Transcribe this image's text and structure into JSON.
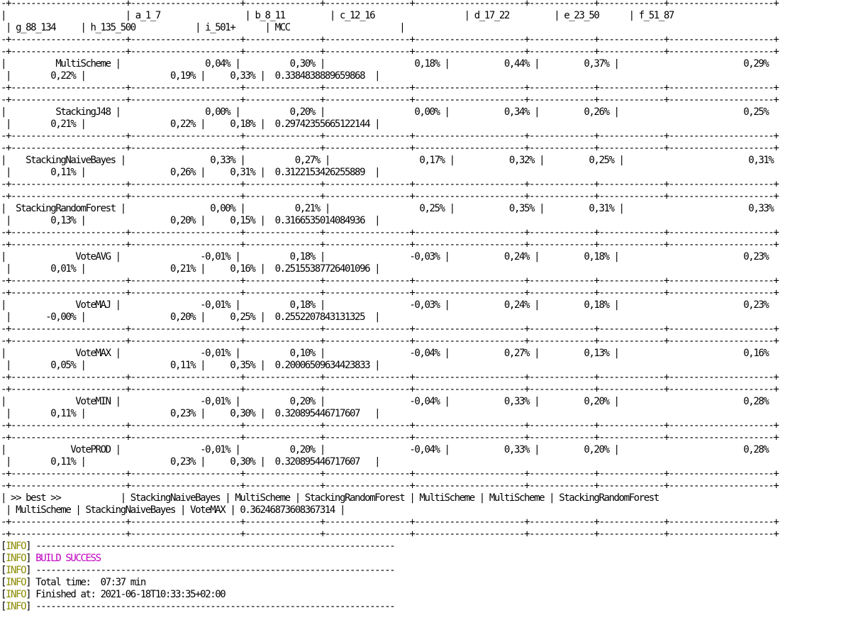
{
  "colors": {
    "background": "#ffffff",
    "text": "#000000",
    "info_label": "#8b8b00",
    "build_success": "#c000c0"
  },
  "table": {
    "border_line": "-+-----------------------+----------------------+---------------+-----------------+----------------------+-------------+-------------+---------------------+",
    "header": [
      "|                        | a_1_7                 | b_8_11         | c_12_16                  | d_17_22         | e_23_50      | f_51_87",
      " | g_88_134     | h_135_500            | i_501+      | MCC                      |"
    ],
    "rows": [
      {
        "name": "MultiScheme",
        "lines": [
          "|          MultiScheme |                 0,04% |          0,30% |                  0,18% |           0,44% |         0,37% |                         0,29%",
          " |        0,22% |                 0,19% |     0,33% |  0.3384838889659868  |"
        ]
      },
      {
        "name": "StackingJ48",
        "lines": [
          "|          StackingJ48 |                 0,00% |          0,20% |                  0,00% |           0,34% |         0,26% |                         0,25%",
          " |        0,21% |                 0,22% |     0,18% |  0.29742355665122144 |"
        ]
      },
      {
        "name": "StackingNaiveBayes",
        "lines": [
          "|    StackingNaiveBayes |                 0,33% |          0,27% |                  0,17% |           0,32% |         0,25% |                         0,31%",
          " |        0,11% |                 0,26% |     0,31% |  0.3122153426255889  |"
        ]
      },
      {
        "name": "StackingRandomForest",
        "lines": [
          "|  StackingRandomForest |                 0,00% |          0,21% |                  0,25% |           0,35% |         0,31% |                         0,33%",
          " |        0,13% |                 0,20% |     0,15% |  0.3166535014084936  |"
        ]
      },
      {
        "name": "VoteAVG",
        "lines": [
          "|              VoteAVG |                -0,01% |          0,18% |                 -0,03% |           0,24% |         0,18% |                         0,23%",
          " |        0,01% |                 0,21% |     0,16% |  0.25155387726401096 |"
        ]
      },
      {
        "name": "VoteMAJ",
        "lines": [
          "|              VoteMAJ |                -0,01% |          0,18% |                 -0,03% |           0,24% |         0,18% |                         0,23%",
          " |       -0,00% |                 0,20% |     0,25% |  0.2552207843131325  |"
        ]
      },
      {
        "name": "VoteMAX",
        "lines": [
          "|              VoteMAX |                -0,01% |          0,10% |                 -0,04% |           0,27% |         0,13% |                         0,16%",
          " |        0,05% |                 0,11% |     0,35% |  0.20006509634423833 |"
        ]
      },
      {
        "name": "VoteMIN",
        "lines": [
          "|              VoteMIN |                -0,01% |          0,20% |                 -0,04% |           0,33% |         0,20% |                         0,28%",
          " |        0,11% |                 0,23% |     0,30% |  0.320895446717607   |"
        ]
      },
      {
        "name": "VotePROD",
        "lines": [
          "|             VotePROD |                -0,01% |          0,20% |                 -0,04% |           0,33% |         0,20% |                         0,28%",
          " |        0,11% |                 0,23% |     0,30% |  0.320895446717607   |"
        ]
      }
    ],
    "best": [
      "| >> best >>            | StackingNaiveBayes | MultiScheme | StackingRandomForest | MultiScheme | MultiScheme | StackingRandomForest",
      " | MultiScheme | StackingNaiveBayes | VoteMAX | 0.36246873608367314 |"
    ]
  },
  "log": {
    "tag_open": "[",
    "tag_word": "INFO",
    "tag_close": "] ",
    "separator": "------------------------------------------------------------------------",
    "build_status": "BUILD SUCCESS",
    "total_time": "Total time:  07:37 min",
    "finished_at": "Finished at: 2021-06-18T10:33:35+02:00"
  }
}
